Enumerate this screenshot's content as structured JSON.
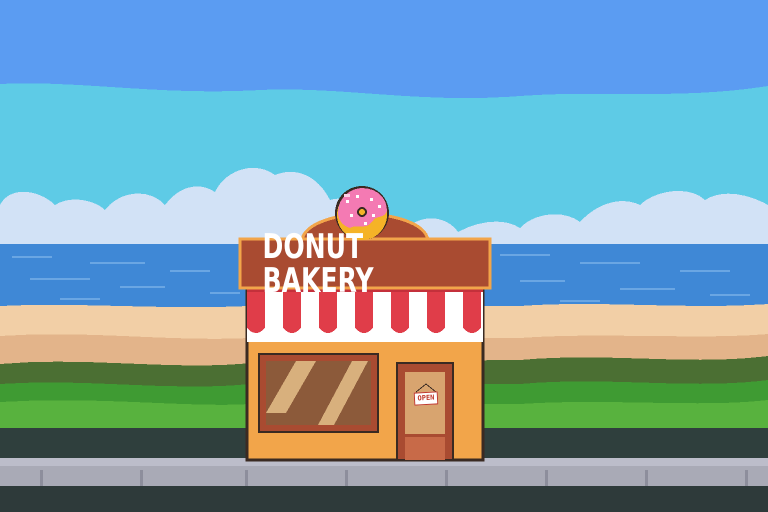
{
  "scene": {
    "shop_sign": "DONUT BAKERY",
    "door_sign": "OPEN"
  },
  "icons": {
    "donut": "donut-icon"
  },
  "colors": {
    "sky_top": "#5b9cf2",
    "sky_band": "#5ecbe6",
    "clouds": "#d2e2f6",
    "sea": "#3f88d6",
    "sand": "#f2cfa6",
    "grass": "#3f9b33",
    "sidewalk": "#a9aab6",
    "road": "#2e3a3a",
    "sign_board": "#a94b31",
    "awning_red": "#e03d49",
    "shop_wall": "#f2a54a",
    "donut_frosting": "#f47ab3"
  }
}
